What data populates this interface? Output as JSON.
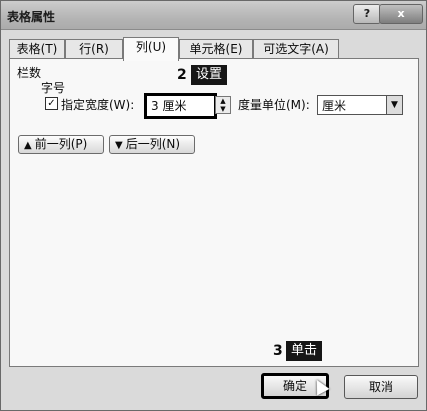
{
  "window": {
    "title": "表格属性",
    "help_label": "?",
    "close_label": "x"
  },
  "tabs": [
    {
      "label": "表格(T)",
      "active": false
    },
    {
      "label": "行(R)",
      "active": false
    },
    {
      "label": "列(U)",
      "active": true
    },
    {
      "label": "单元格(E)",
      "active": false
    },
    {
      "label": "可选文字(A)",
      "active": false
    }
  ],
  "column": {
    "section_label": "栏数",
    "column_name": "字号",
    "specify_width_label": "指定宽度(W):",
    "specify_width_checked": true,
    "width_value": "3 厘米",
    "measure_label": "度量单位(M):",
    "measure_value": "厘米"
  },
  "nav": {
    "prev_label": "前一列(P)",
    "next_label": "后一列(N)"
  },
  "annotations": {
    "step2_num": "2",
    "step2_text": "设置",
    "step3_num": "3",
    "step3_text": "单击"
  },
  "footer": {
    "ok_label": "确定",
    "cancel_label": "取消"
  }
}
